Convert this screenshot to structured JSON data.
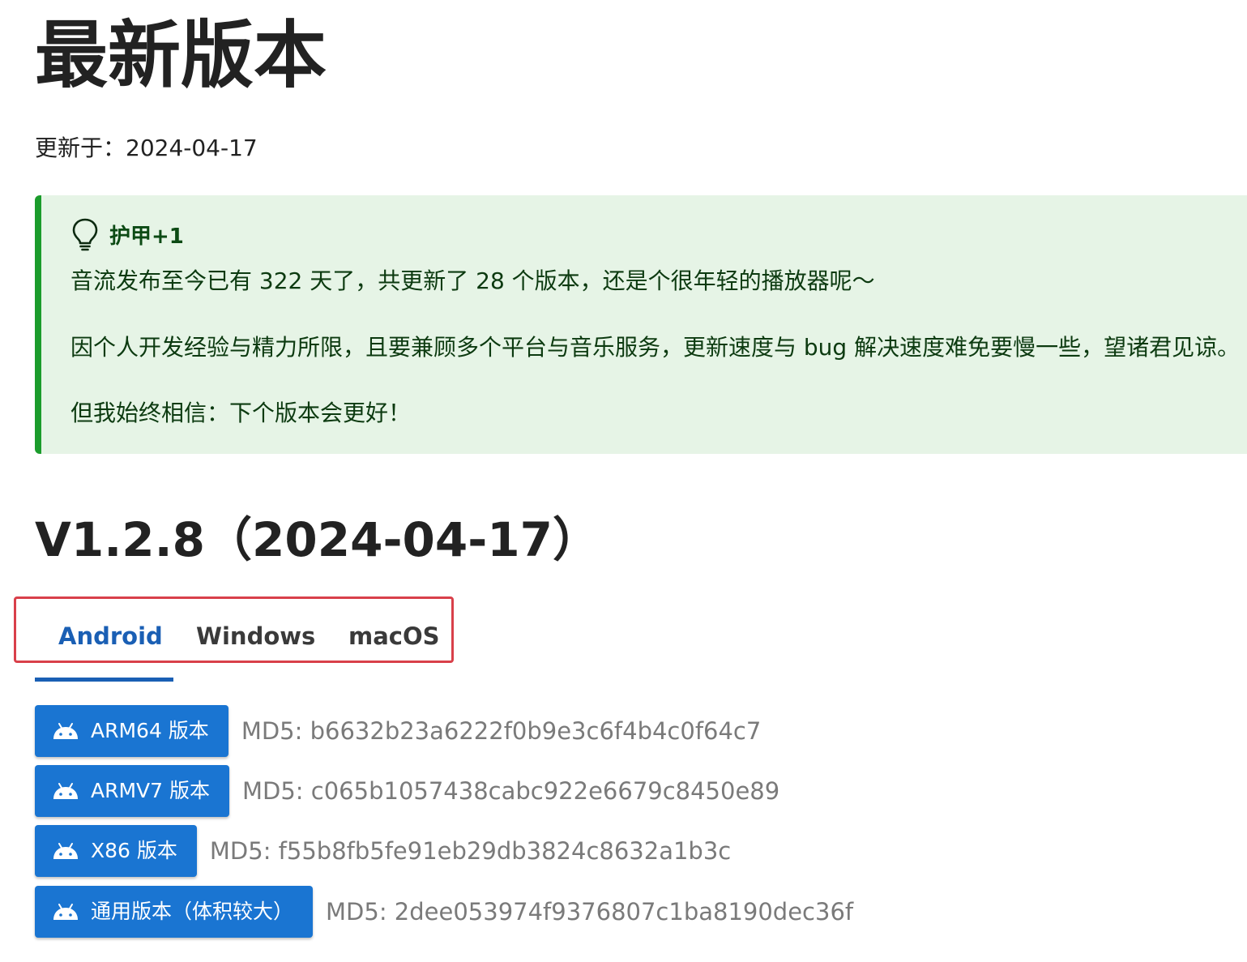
{
  "page": {
    "title": "最新版本",
    "updated": "更新于：2024-04-17"
  },
  "tip": {
    "icon": "lightbulb-icon",
    "title": "护甲+1",
    "lines": [
      "音流发布至今已有 322 天了，共更新了 28 个版本，还是个很年轻的播放器呢～",
      "因个人开发经验与精力所限，且要兼顾多个平台与音乐服务，更新速度与 bug 解决速度难免要慢一些，望诸君见谅。",
      "但我始终相信：下个版本会更好！"
    ],
    "colors": {
      "background": "#e6f4e6",
      "border": "#1b9c2c"
    }
  },
  "release": {
    "heading": "V1.2.8（2024-04-17）",
    "tabs": [
      {
        "label": "Android",
        "active": true
      },
      {
        "label": "Windows",
        "active": false
      },
      {
        "label": "macOS",
        "active": false
      }
    ],
    "downloads": [
      {
        "label": "ARM64 版本",
        "md5": "MD5: b6632b23a6222f0b9e3c6f4b4c0f64c7",
        "icon": "android-icon"
      },
      {
        "label": "ARMV7 版本",
        "md5": "MD5: c065b1057438cabc922e6679c8450e89",
        "icon": "android-icon"
      },
      {
        "label": "X86 版本",
        "md5": "MD5: f55b8fb5fe91eb29db3824c8632a1b3c",
        "icon": "android-icon"
      },
      {
        "label": "通用版本（体积较大）",
        "md5": "MD5: 2dee053974f9376807c1ba8190dec36f",
        "icon": "android-icon"
      }
    ],
    "colors": {
      "accent": "#1a5fb4",
      "button": "#1a75d2",
      "highlight": "#d9404a"
    }
  }
}
